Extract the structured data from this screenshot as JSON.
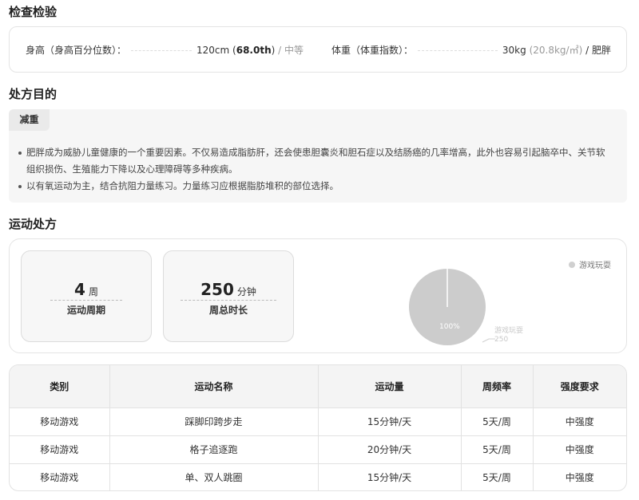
{
  "exam": {
    "title": "检查检验",
    "height": {
      "label": "身高（身高百分位数）：",
      "value": "120cm",
      "percentile": "68.0th",
      "sep": "/",
      "level": "中等"
    },
    "weight": {
      "label": "体重（体重指数）：",
      "value": "30kg",
      "bmi": "20.8kg/㎡",
      "sep": "/",
      "level": "肥胖"
    }
  },
  "purpose": {
    "title": "处方目的",
    "tag": "减重",
    "bullets": [
      "肥胖成为威胁儿童健康的一个重要因素。不仅易造成脂肪肝，还会使患胆囊炎和胆石症以及结肠癌的几率增高，此外也容易引起脑卒中、关节软组织损伤、生殖能力下降以及心理障碍等多种疾病。",
      "以有氧运动为主，结合抗阻力量练习。力量练习应根据脂肪堆积的部位选择。"
    ]
  },
  "exercise": {
    "title": "运动处方",
    "period": {
      "value": "4",
      "unit": "周",
      "label": "运动周期"
    },
    "weekly": {
      "value": "250",
      "unit": "分钟",
      "label": "周总时长"
    }
  },
  "chart_data": {
    "type": "pie",
    "categories": [
      "游戏玩耍"
    ],
    "values": [
      250
    ],
    "percent_labels": [
      "100%"
    ],
    "legend": "top-right",
    "colors": [
      "#cccccc"
    ]
  },
  "table": {
    "headers": [
      "类别",
      "运动名称",
      "运动量",
      "周频率",
      "强度要求"
    ],
    "rows": [
      [
        "移动游戏",
        "踩脚印跨步走",
        "15分钟/天",
        "5天/周",
        "中强度"
      ],
      [
        "移动游戏",
        "格子追逐跑",
        "20分钟/天",
        "5天/周",
        "中强度"
      ],
      [
        "移动游戏",
        "单、双人跳圈",
        "15分钟/天",
        "5天/周",
        "中强度"
      ]
    ]
  }
}
